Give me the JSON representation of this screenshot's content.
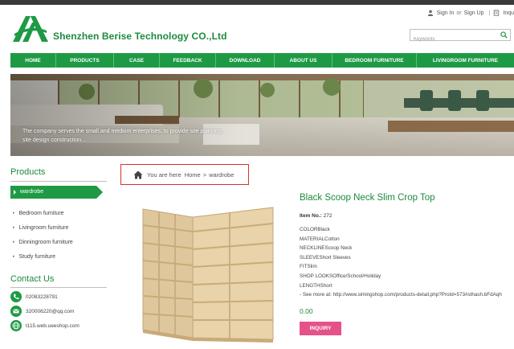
{
  "header": {
    "company_name": "Shenzhen Berise Technology CO.,Ltd",
    "sign_in": "Sign In",
    "or": "or",
    "sign_up": "Sign Up",
    "pipe": "|",
    "inquiry_link": "Inqu",
    "search_placeholder": "Keywords"
  },
  "nav": [
    {
      "label": "HOME"
    },
    {
      "label": "PRODUCTS"
    },
    {
      "label": "CASE"
    },
    {
      "label": "FEEDBACK"
    },
    {
      "label": "DOWNLOAD"
    },
    {
      "label": "ABOUT US"
    },
    {
      "label": "BEDROOM FURNITURE"
    },
    {
      "label": "LIVINGROOM FURNITURE"
    }
  ],
  "banner": {
    "caption": "The company serves the small and medium enterprises, to provide site planning, site design construction..."
  },
  "sidebar": {
    "products_title": "Products",
    "active_category": "wardrobe",
    "categories": [
      {
        "label": "Bedroom furniture"
      },
      {
        "label": "Livingroom furniture"
      },
      {
        "label": "Dinningroom furniture"
      },
      {
        "label": "Study furniture"
      }
    ],
    "contact_title": "Contact Us",
    "contacts": [
      {
        "icon": "phone-icon",
        "text": "02083228791"
      },
      {
        "icon": "email-icon",
        "text": "320006220@qq.com"
      },
      {
        "icon": "globe-icon",
        "text": "t115.web.ueeshop.com"
      }
    ]
  },
  "breadcrumb": {
    "prefix": "You are here",
    "home": "Home",
    "separator": ">",
    "current": "wardrobe"
  },
  "product": {
    "title": "Black Scoop Neck Slim Crop Top",
    "item_no_label": "Item No.:",
    "item_no": "272",
    "specs": [
      "COLORBlack",
      "MATERIALCotton",
      "NECKLINEScoop Neck",
      "SLEEVEShort Sleeves",
      "FITSlim",
      "SHOP LOOKSOffice/School/Holiday",
      "LENGTHShort",
      "- See more at: http://www.simingshop.com/products-detail.php?ProId=573#sthash.bFdAqh"
    ],
    "price": "0.00",
    "inquiry_button": "INQUIRY"
  },
  "colors": {
    "brand_green": "#1e9a45",
    "title_green": "#1c8a3e",
    "inquiry_pink": "#e5528a",
    "breadcrumb_border": "#d9302c"
  }
}
